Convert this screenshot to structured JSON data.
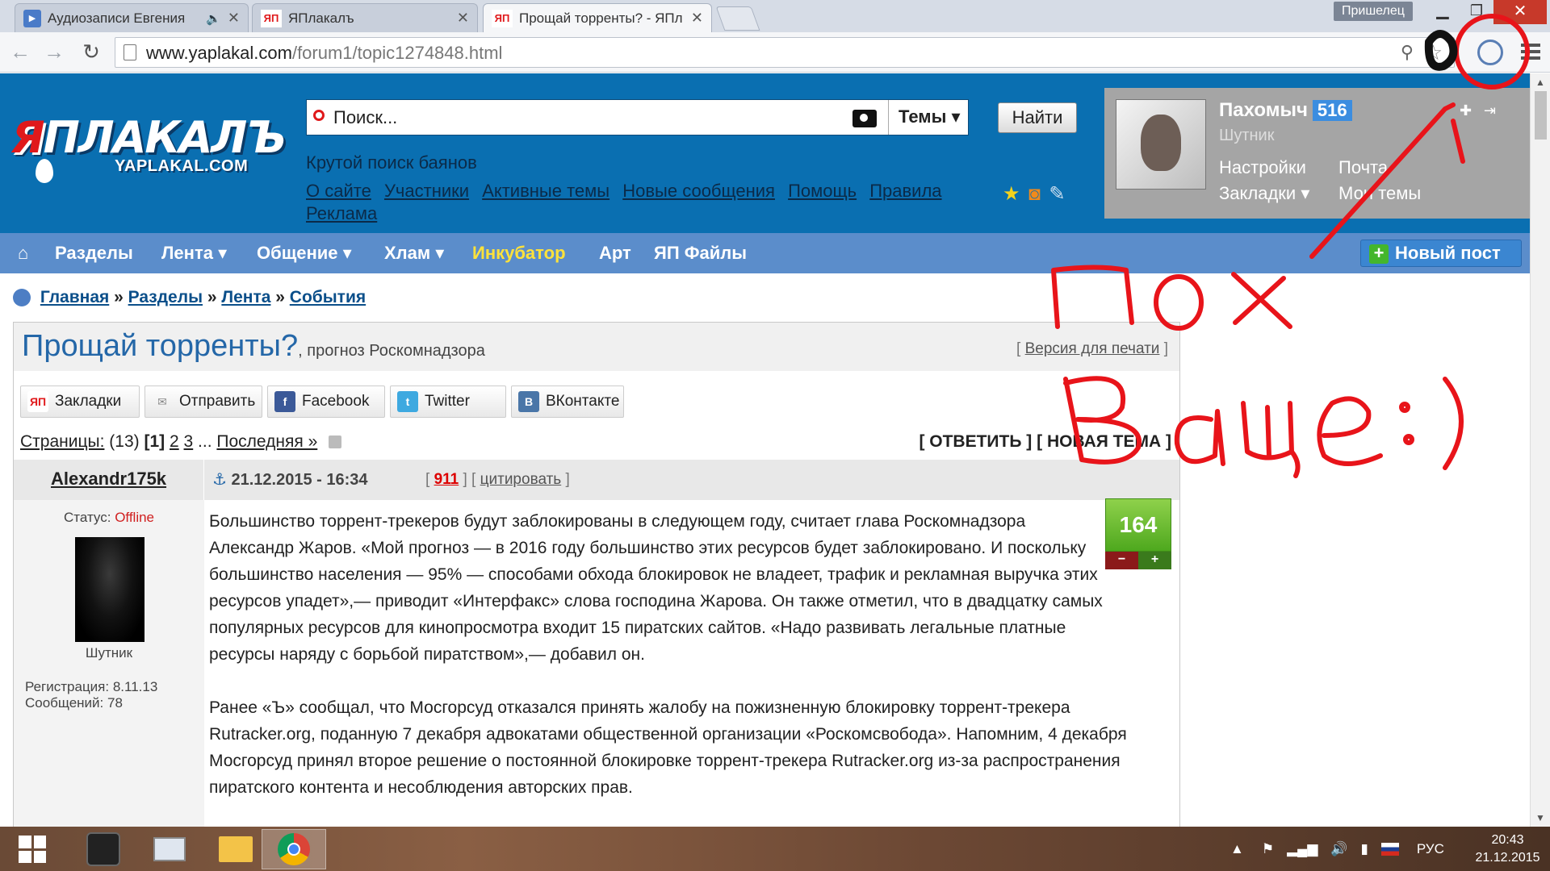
{
  "browser": {
    "tabs": [
      {
        "title": "Аудиозаписи Евгения",
        "favicon": "play-icon",
        "audio": true,
        "active": false
      },
      {
        "title": "ЯПлакалъ",
        "favicon": "ЯП",
        "active": false
      },
      {
        "title": "Прощай торренты? - ЯПл",
        "favicon": "ЯП",
        "active": true
      }
    ],
    "profile_label": "Пришелец",
    "url_host": "www.yaplakal.com",
    "url_path": "/forum1/topic1274848.html"
  },
  "site": {
    "logo_word": "ЯПЛАКАЛЪ",
    "logo_ya": "Я",
    "logo_rest": "ПЛАКАЛЪ",
    "logo_sub": "YAPLAKAL.COM",
    "search_placeholder": "Поиск...",
    "search_scope": "Темы",
    "search_button": "Найти",
    "tagline": "Крутой поиск баянов",
    "header_links": [
      "О сайте",
      "Участники",
      "Активные темы",
      "Новые сообщения",
      "Помощь",
      "Правила",
      "Реклама"
    ]
  },
  "user": {
    "name": "Пахомыч",
    "rep": "516",
    "rank": "Шутник",
    "links": {
      "settings": "Настройки",
      "mail": "Почта",
      "bookmarks": "Закладки",
      "my_topics": "Мои темы"
    }
  },
  "nav": {
    "items": [
      "Разделы",
      "Лента",
      "Общение",
      "Хлам",
      "Инкубатор",
      "Арт",
      "ЯП Файлы"
    ],
    "dropdown": [
      false,
      true,
      true,
      true,
      false,
      false,
      false
    ],
    "new_post": "Новый пост"
  },
  "breadcrumb": [
    "Главная",
    "Разделы",
    "Лента",
    "События"
  ],
  "topic": {
    "title": "Прощай торренты?",
    "subtitle": ", прогноз Роскомнадзора",
    "print_link": "Версия для печати",
    "share": [
      "Закладки",
      "Отправить",
      "Facebook",
      "Twitter",
      "ВКонтакте"
    ],
    "pages_label": "Страницы:",
    "pages_count": "(13)",
    "page_current": "[1]",
    "page_links": [
      "2",
      "3"
    ],
    "page_last": "Последняя »",
    "reply": "[ ОТВЕТИТЬ ]",
    "new_topic": "[ НОВАЯ ТЕМА ]"
  },
  "post": {
    "author": "Alexandr175k",
    "date": "21.12.2015 - 16:34",
    "number": "911",
    "quote": "цитировать",
    "status_label": "Статус:",
    "status_value": "Offline",
    "rank": "Шутник",
    "registered": "Регистрация: 8.11.13",
    "messages": "Сообщений: 78",
    "rating": "164",
    "paragraphs": [
      "Большинство торрент-трекеров будут заблокированы в следующем году, считает глава Роскомнадзора Александр Жаров. «Мой прогноз — в 2016 году большинство этих ресурсов будет заблокировано. И поскольку большинство населения — 95% — способами обхода блокировок не владеет, трафик и рекламная выручка этих ресурсов упадет»,— приводит «Интерфакс» слова господина Жарова. Он также отметил, что в двадцатку самых популярных ресурсов для кинопросмотра входит 15 пиратских сайтов. «Надо развивать легальные платные ресурсы наряду с борьбой пиратством»,— добавил он.",
      "Ранее «Ъ» сообщал, что Мосгорсуд отказался принять жалобу на пожизненную блокировку торрент-трекера Rutracker.org, поданную 7 декабря адвокатами общественной организации «Роскомсвобода». Напомним, 4 декабря Мосгорсуд принял второе решение о постоянной блокировке торрент-трекера Rutracker.org из-за распространения пиратского контента и несоблюдения авторских прав."
    ]
  },
  "taskbar": {
    "lang": "РУС",
    "time": "20:43",
    "date": "21.12.2015"
  },
  "colors": {
    "header_blue": "#0a6fb1",
    "nav_blue": "#5b8dcb",
    "accent_red": "#e0191b",
    "incubator_yellow": "#ffe23a",
    "scribble_red": "#e8141a"
  }
}
